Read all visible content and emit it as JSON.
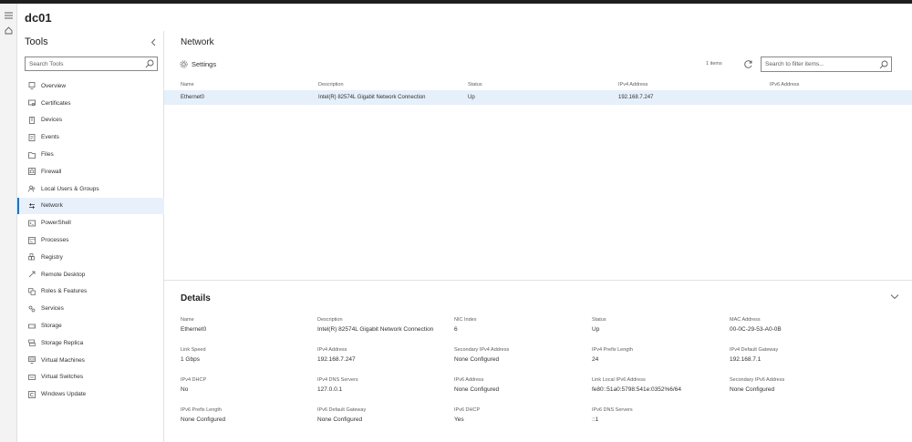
{
  "server": {
    "name": "dc01"
  },
  "tools": {
    "title": "Tools",
    "search_placeholder": "Search Tools",
    "items": [
      {
        "label": "Overview",
        "icon": "overview-icon"
      },
      {
        "label": "Certificates",
        "icon": "certificate-icon"
      },
      {
        "label": "Devices",
        "icon": "devices-icon"
      },
      {
        "label": "Events",
        "icon": "events-icon"
      },
      {
        "label": "Files",
        "icon": "files-icon"
      },
      {
        "label": "Firewall",
        "icon": "firewall-icon"
      },
      {
        "label": "Local Users & Groups",
        "icon": "users-icon"
      },
      {
        "label": "Network",
        "icon": "network-icon",
        "active": true
      },
      {
        "label": "PowerShell",
        "icon": "powershell-icon"
      },
      {
        "label": "Processes",
        "icon": "processes-icon"
      },
      {
        "label": "Registry",
        "icon": "registry-icon"
      },
      {
        "label": "Remote Desktop",
        "icon": "remote-desktop-icon"
      },
      {
        "label": "Roles & Features",
        "icon": "roles-icon"
      },
      {
        "label": "Services",
        "icon": "services-icon"
      },
      {
        "label": "Storage",
        "icon": "storage-icon"
      },
      {
        "label": "Storage Replica",
        "icon": "storage-replica-icon"
      },
      {
        "label": "Virtual Machines",
        "icon": "vm-icon"
      },
      {
        "label": "Virtual Switches",
        "icon": "switch-icon"
      },
      {
        "label": "Windows Update",
        "icon": "update-icon"
      }
    ]
  },
  "network": {
    "title": "Network",
    "settings_label": "Settings",
    "items_count": "1 items",
    "filter_placeholder": "Search to filter items...",
    "columns": [
      "Name",
      "Description",
      "Status",
      "IPv4 Address",
      "IPv6 Address"
    ],
    "rows": [
      {
        "name": "Ethernet0",
        "description": "Intel(R) 82574L Gigabit Network Connection",
        "status": "Up",
        "ipv4": "192.168.7.247",
        "ipv6": ""
      }
    ]
  },
  "details": {
    "title": "Details",
    "fields": [
      {
        "label": "Name",
        "value": "Ethernet0"
      },
      {
        "label": "Description",
        "value": "Intel(R) 82574L Gigabit Network Connection"
      },
      {
        "label": "NIC Index",
        "value": "6"
      },
      {
        "label": "Status",
        "value": "Up"
      },
      {
        "label": "MAC Address",
        "value": "00-0C-29-53-A0-0B"
      },
      {
        "label": "Link Speed",
        "value": "1 Gbps"
      },
      {
        "label": "IPv4 Address",
        "value": "192.168.7.247"
      },
      {
        "label": "Secondary IPv4 Address",
        "value": "None Configured"
      },
      {
        "label": "IPv4 Prefix Length",
        "value": "24"
      },
      {
        "label": "IPv4 Default Gateway",
        "value": "192.168.7.1"
      },
      {
        "label": "IPv4 DHCP",
        "value": "No"
      },
      {
        "label": "IPv4 DNS Servers",
        "value": "127.0.0.1"
      },
      {
        "label": "IPv6 Address",
        "value": "None Configured"
      },
      {
        "label": "Link Local IPv6 Address",
        "value": "fe80::51a0:5798:541e:0352%6/64"
      },
      {
        "label": "Secondary IPv6 Address",
        "value": "None Configured"
      },
      {
        "label": "IPv6 Prefix Length",
        "value": "None Configured"
      },
      {
        "label": "IPv6 Default Gateway",
        "value": "None Configured"
      },
      {
        "label": "IPv6 DHCP",
        "value": "Yes"
      },
      {
        "label": "IPv6 DNS Servers",
        "value": "::1"
      }
    ]
  },
  "colors": {
    "accent": "#0078d4",
    "selected_row": "#e5f0fb",
    "text": "#252423",
    "muted": "#605e5c"
  }
}
